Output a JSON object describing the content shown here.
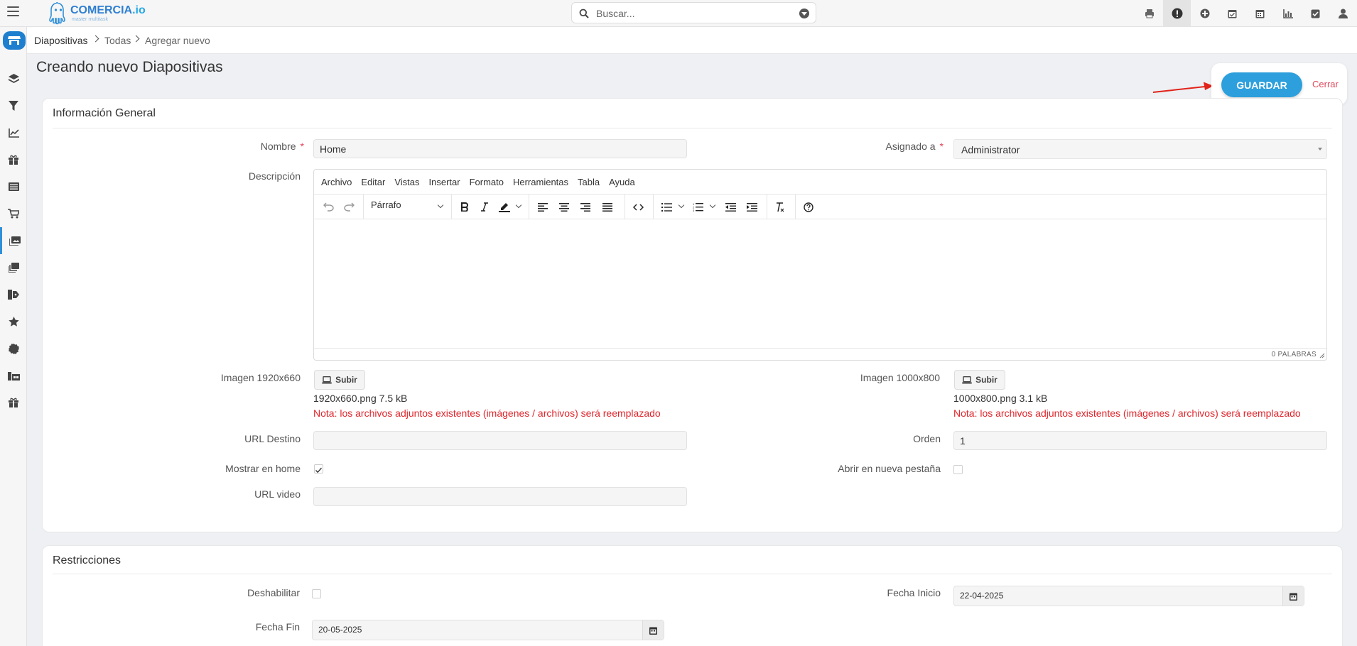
{
  "app": {
    "brand_name": "COMERCIA",
    "brand_suffix": ".io",
    "brand_tagline": "master multitask",
    "accent_color": "#2d9fdc"
  },
  "search": {
    "placeholder": "Buscar..."
  },
  "top_icons": [
    "print-icon",
    "alert-icon",
    "add-circle-icon",
    "calendar-check-icon",
    "calendar-icon",
    "chart-icon",
    "task-check-icon",
    "user-icon"
  ],
  "sidebar_icons": [
    "store-icon",
    "layers-icon",
    "filter-icon",
    "trend-chart-icon",
    "gift-icon",
    "list-icon",
    "cart-icon",
    "slides-icon",
    "copies-icon",
    "tags-icon",
    "star-icon",
    "badge-icon",
    "warehouse-icon",
    "gift-icon"
  ],
  "breadcrumb": {
    "items": [
      "Diapositivas",
      "Todas",
      "Agregar nuevo"
    ]
  },
  "page": {
    "title": "Creando nuevo Diapositivas"
  },
  "actions": {
    "save_label": "GUARDAR",
    "close_label": "Cerrar"
  },
  "general": {
    "section_title": "Información General",
    "nombre_label": "Nombre",
    "nombre_value": "Home",
    "asignado_label": "Asignado a",
    "asignado_value": "Administrator",
    "descripcion_label": "Descripción",
    "editor": {
      "menu": [
        "Archivo",
        "Editar",
        "Vistas",
        "Insertar",
        "Formato",
        "Herramientas",
        "Tabla",
        "Ayuda"
      ],
      "block_format": "Párrafo",
      "word_count": "0 PALABRAS"
    },
    "imagen1_label": "Imagen 1920x660",
    "imagen1_file": "1920x660.png 7.5 kB",
    "imagen2_label": "Imagen 1000x800",
    "imagen2_file": "1000x800.png 3.1 kB",
    "upload_label": "Subir",
    "replace_note": "Nota: los archivos adjuntos existentes (imágenes / archivos) será reemplazado",
    "url_destino_label": "URL Destino",
    "url_destino_value": "",
    "orden_label": "Orden",
    "orden_value": "1",
    "mostrar_home_label": "Mostrar en home",
    "mostrar_home_checked": true,
    "nueva_pestana_label": "Abrir en nueva pestaña",
    "nueva_pestana_checked": false,
    "url_video_label": "URL video",
    "url_video_value": ""
  },
  "restricciones": {
    "section_title": "Restricciones",
    "deshabilitar_label": "Deshabilitar",
    "deshabilitar_checked": false,
    "fecha_inicio_label": "Fecha Inicio",
    "fecha_inicio_value": "22-04-2025",
    "fecha_fin_label": "Fecha Fin",
    "fecha_fin_value": "20-05-2025"
  }
}
